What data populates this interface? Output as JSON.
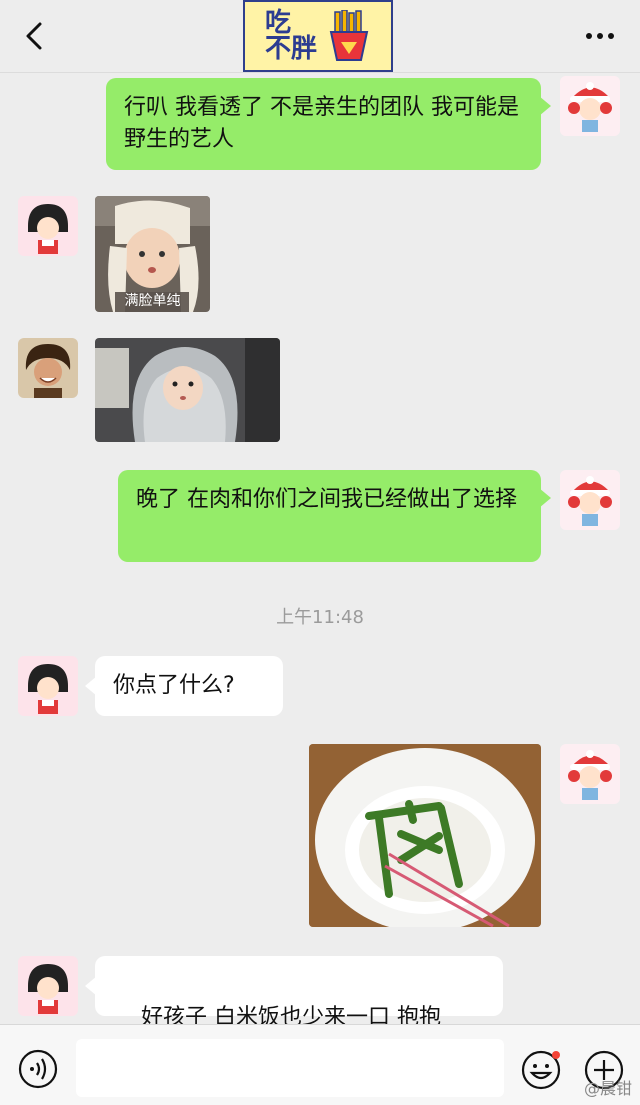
{
  "header": {
    "badge_line1": "吃",
    "badge_line2": "不胖",
    "icons": [
      "chevron-left-icon",
      "more-dots-icon",
      "fries-logo-icon"
    ]
  },
  "messages": [
    {
      "side": "me",
      "text": "行叭 我看透了 不是亲生的团队 我可能是野生的艺人"
    },
    {
      "side": "other",
      "type": "image",
      "caption": "满脸单纯"
    },
    {
      "side": "other",
      "type": "image"
    },
    {
      "side": "me",
      "text": "晚了 在肉和你们之间我已经做出了选择"
    },
    {
      "side": "other",
      "text": "你点了什么?"
    },
    {
      "side": "me",
      "type": "image",
      "subject": "rice bowl with green beans"
    },
    {
      "side": "other",
      "text": "好孩子 白米饭也少来一口 抱抱"
    }
  ],
  "timestamp": "上午11:48",
  "input": {
    "placeholder": ""
  },
  "watermark": "@晨钳",
  "colors": {
    "me_bubble": "#95ec69",
    "other_bubble": "#ffffff",
    "background": "#ededed",
    "accent_badge": "#fff3a6"
  }
}
